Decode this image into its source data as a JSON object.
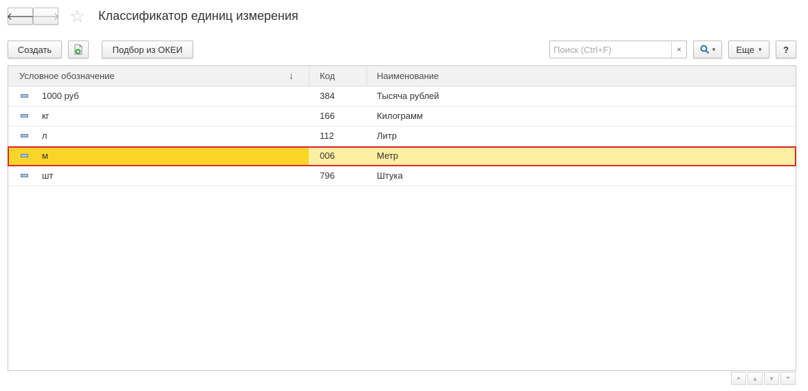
{
  "window": {
    "title": "Классификатор единиц измерения"
  },
  "nav": {
    "back_glyph": "🡐",
    "forward_glyph": "🡒",
    "back_icon": "arrow-left-icon",
    "forward_icon": "arrow-right-icon",
    "star_glyph": "☆"
  },
  "toolbar": {
    "create_label": "Создать",
    "okei_label": "Подбор из ОКЕИ",
    "more_label": "Еще",
    "help_label": "?",
    "search_placeholder": "Поиск (Ctrl+F)",
    "search_value": "",
    "clear_glyph": "×",
    "dropdown_glyph": "▾"
  },
  "table": {
    "columns": [
      "Условное обозначение",
      "Код",
      "Наименование"
    ],
    "sort_indicator": "↓",
    "rows": [
      {
        "symbol": "1000 руб",
        "code": "384",
        "name": "Тысяча рублей"
      },
      {
        "symbol": "кг",
        "code": "166",
        "name": "Килограмм"
      },
      {
        "symbol": "л",
        "code": "112",
        "name": "Литр"
      },
      {
        "symbol": "м",
        "code": "006",
        "name": "Метр"
      },
      {
        "symbol": "шт",
        "code": "796",
        "name": "Штука"
      }
    ],
    "selected_row": 3
  },
  "colors": {
    "selected_cell": "#f8d528",
    "selected_row": "#fcefa2",
    "highlight_frame": "#e0262b"
  }
}
